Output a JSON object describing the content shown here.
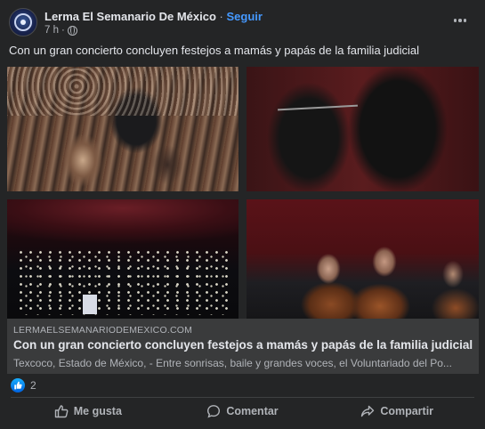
{
  "post": {
    "author": "Lerma El Semanario De México",
    "separator": "·",
    "follow_label": "Seguir",
    "timestamp": "7 h",
    "meta_separator": "·",
    "privacy_icon": "globe-icon",
    "caption": "Con un gran concierto concluyen festejos a mamás y papás de la familia judicial"
  },
  "photos": [
    {
      "icon": "audience-applauding-photo"
    },
    {
      "icon": "conductor-close-up-photo"
    },
    {
      "icon": "theater-phone-lights-photo"
    },
    {
      "icon": "orchestra-violinists-photo"
    }
  ],
  "link_preview": {
    "domain": "LERMAELSEMANARIODEMEXICO.COM",
    "title": "Con un gran concierto concluyen festejos a mamás y papás de la familia judicial",
    "description": "Texcoco, Estado de México, - Entre sonrisas, baile y grandes voces, el Voluntariado del Po..."
  },
  "reactions": {
    "icon": "like-reaction-icon",
    "count": "2"
  },
  "actions": [
    {
      "label": "Me gusta",
      "icon": "thumbs-up-icon"
    },
    {
      "label": "Comentar",
      "icon": "comment-icon"
    },
    {
      "label": "Compartir",
      "icon": "share-icon"
    }
  ],
  "colors": {
    "card_bg": "#242526",
    "link_box_bg": "#3a3b3c",
    "accent": "#4599ff",
    "text_primary": "#e4e6eb",
    "text_secondary": "#b0b3b8"
  }
}
